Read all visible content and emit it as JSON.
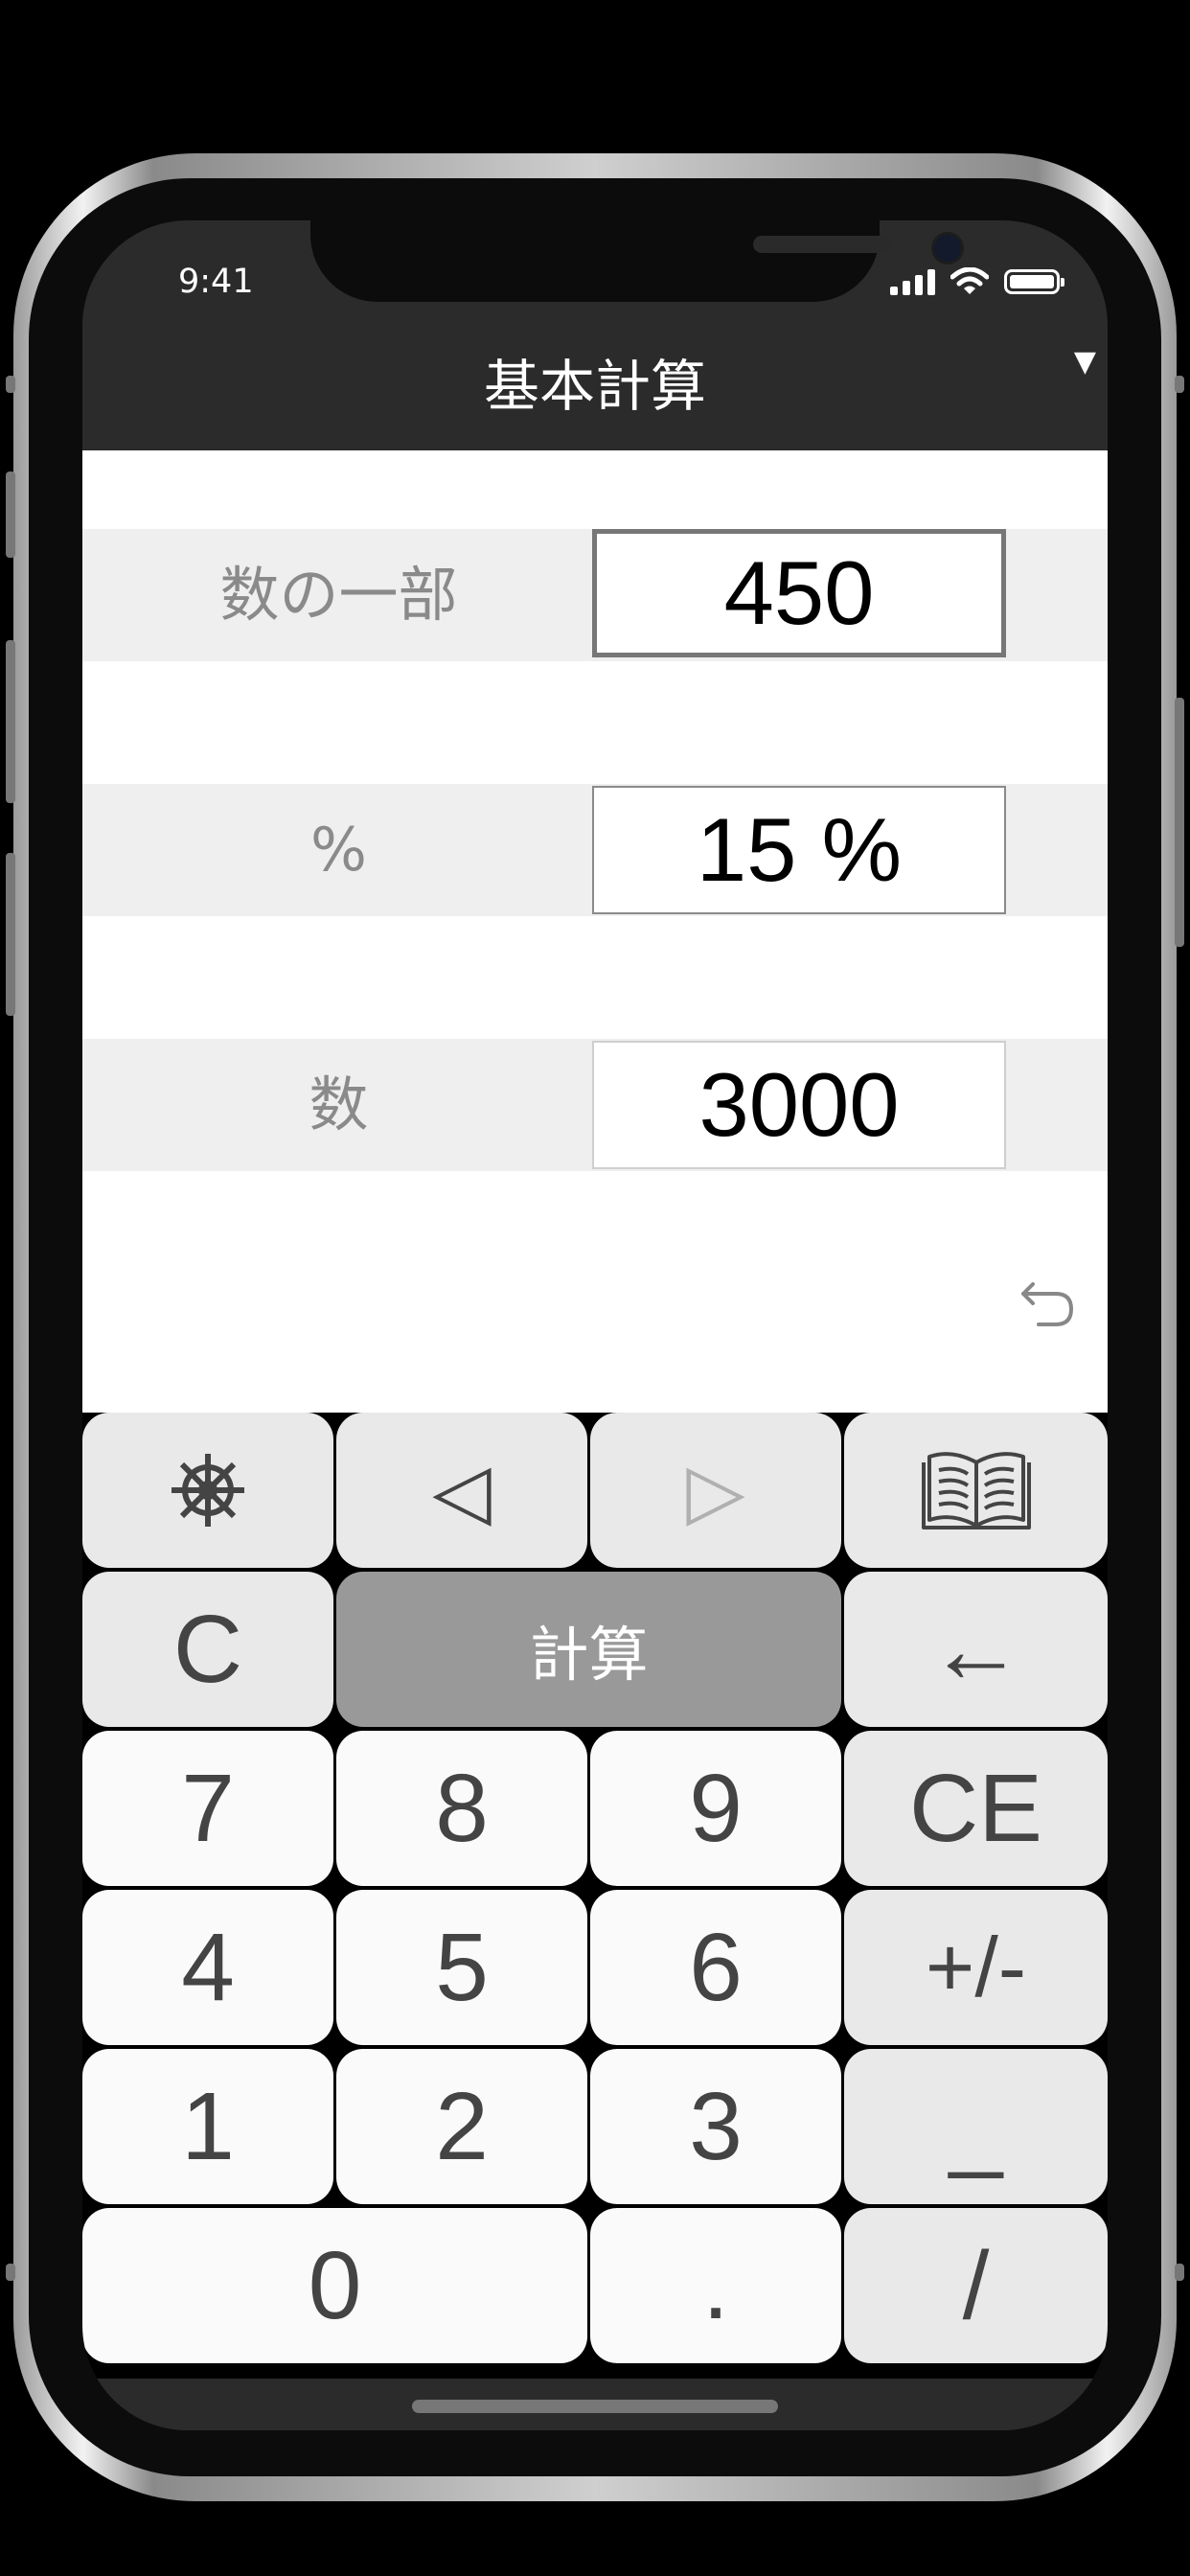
{
  "status_bar": {
    "time": "9:41"
  },
  "nav": {
    "title": "基本計算",
    "menu_icon": "triangle-down-icon"
  },
  "rows": [
    {
      "label": "数の一部",
      "value": "450"
    },
    {
      "label": "%",
      "value": "15 %"
    },
    {
      "label": "数",
      "value": "3000"
    }
  ],
  "keypad": {
    "settings_icon": "helm-icon",
    "back_arrow": "◁",
    "forward_arrow": "▷",
    "book_icon": "book-icon",
    "clear": "C",
    "calculate": "計算",
    "backspace": "←",
    "clear_entry": "CE",
    "plus_minus": "+/-",
    "underscore": "_",
    "slash": "/",
    "dot": ".",
    "digits": [
      "0",
      "1",
      "2",
      "3",
      "4",
      "5",
      "6",
      "7",
      "8",
      "9"
    ]
  },
  "colors": {
    "nav_bg": "#2b2b2b",
    "row_bg": "#efefef",
    "key_bg": "#fafafa",
    "key_gray": "#e9e9e9",
    "calc_button": "#999999"
  }
}
